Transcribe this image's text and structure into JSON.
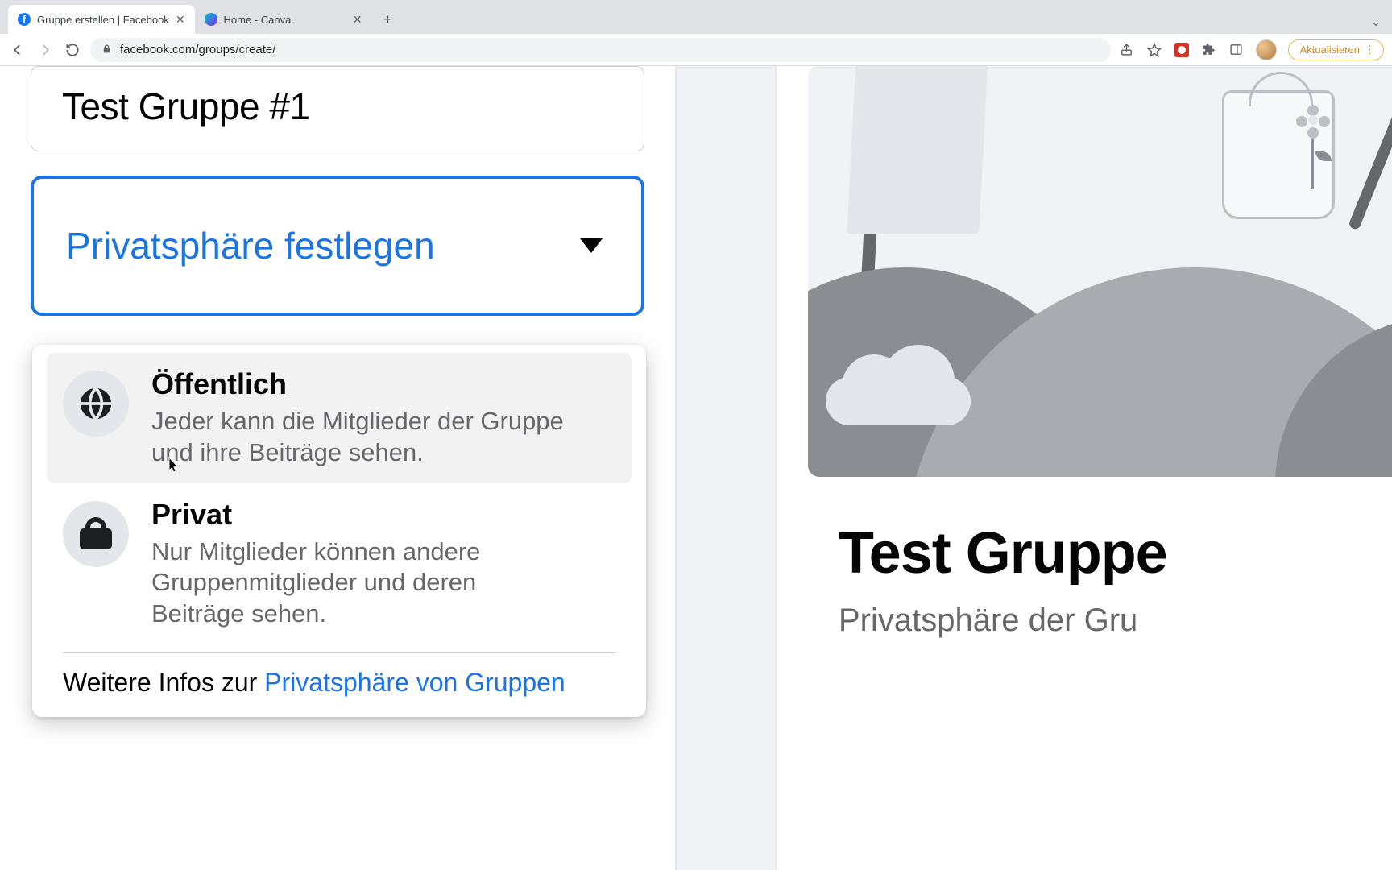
{
  "browser": {
    "tabs": [
      {
        "title": "Gruppe erstellen | Facebook"
      },
      {
        "title": "Home - Canva"
      }
    ],
    "url": "facebook.com/groups/create/",
    "update_label": "Aktualisieren"
  },
  "form": {
    "group_name": "Test Gruppe #1",
    "privacy_label": "Privatsphäre festlegen"
  },
  "privacy_options": {
    "public": {
      "title": "Öffentlich",
      "desc": "Jeder kann die Mitglieder der Gruppe und ihre Beiträge sehen."
    },
    "private": {
      "title": "Privat",
      "desc": "Nur Mitglieder können andere Gruppenmitglieder und deren Beiträge sehen."
    },
    "learn_prefix": "Weitere Infos zur ",
    "learn_link": "Privatsphäre von Gruppen"
  },
  "preview": {
    "title": "Test Gruppe",
    "subtitle": "Privatsphäre der Gru"
  }
}
